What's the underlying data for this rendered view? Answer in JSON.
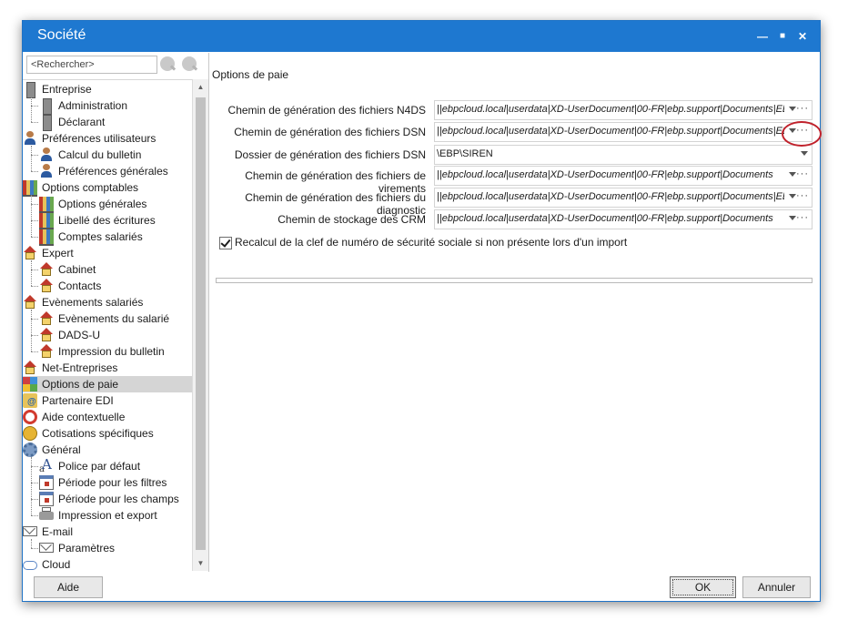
{
  "window": {
    "title": "Société"
  },
  "search": {
    "placeholder": "<Rechercher>"
  },
  "tree": [
    {
      "label": "Entreprise",
      "icon": "building-icon"
    },
    {
      "label": "Administration",
      "icon": "building-icon"
    },
    {
      "label": "Déclarant",
      "icon": "building-icon"
    },
    {
      "label": "Préférences utilisateurs",
      "icon": "user-icon"
    },
    {
      "label": "Calcul du bulletin",
      "icon": "user-icon"
    },
    {
      "label": "Préférences générales",
      "icon": "user-icon"
    },
    {
      "label": "Options comptables",
      "icon": "books-icon"
    },
    {
      "label": "Options générales",
      "icon": "books-icon"
    },
    {
      "label": "Libellé des écritures",
      "icon": "books-icon"
    },
    {
      "label": "Comptes salariés",
      "icon": "books-icon"
    },
    {
      "label": "Expert",
      "icon": "house-icon"
    },
    {
      "label": "Cabinet",
      "icon": "house-icon"
    },
    {
      "label": "Contacts",
      "icon": "house-icon"
    },
    {
      "label": "Evènements salariés",
      "icon": "house-icon"
    },
    {
      "label": "Evènements du salarié",
      "icon": "house-icon"
    },
    {
      "label": "DADS-U",
      "icon": "house-icon"
    },
    {
      "label": "Impression du bulletin",
      "icon": "house-icon"
    },
    {
      "label": "Net-Entreprises",
      "icon": "house-icon"
    },
    {
      "label": "Options de paie",
      "icon": "color-grid-icon"
    },
    {
      "label": "Partenaire EDI",
      "icon": "folder-at-icon"
    },
    {
      "label": "Aide contextuelle",
      "icon": "lifebuoy-icon"
    },
    {
      "label": "Cotisations spécifiques",
      "icon": "coins-icon"
    },
    {
      "label": "Général",
      "icon": "gear-icon"
    },
    {
      "label": "Police par défaut",
      "icon": "font-icon"
    },
    {
      "label": "Période pour les filtres",
      "icon": "calendar-icon"
    },
    {
      "label": "Période pour les champs",
      "icon": "calendar-icon"
    },
    {
      "label": "Impression et export",
      "icon": "printer-icon"
    },
    {
      "label": "E-mail",
      "icon": "mail-icon"
    },
    {
      "label": "Paramètres",
      "icon": "mail-icon"
    },
    {
      "label": "Cloud",
      "icon": "cloud-icon"
    }
  ],
  "panel": {
    "title": "Options de paie"
  },
  "fields": [
    {
      "label": "Chemin de génération des fichiers N4DS",
      "value": "||ebpcloud.local|userdata|XD-UserDocument|00-FR|ebp.support|Documents|EBP|Paie"
    },
    {
      "label": "Chemin de génération des fichiers DSN",
      "value": "||ebpcloud.local|userdata|XD-UserDocument|00-FR|ebp.support|Documents|EBP|Paie"
    },
    {
      "label": "Dossier de génération des fichiers DSN",
      "value": "\\EBP\\SIREN"
    },
    {
      "label": "Chemin de génération des fichiers de virements",
      "value": "||ebpcloud.local|userdata|XD-UserDocument|00-FR|ebp.support|Documents"
    },
    {
      "label": "Chemin de génération des fichiers du diagnostic",
      "value": "||ebpcloud.local|userdata|XD-UserDocument|00-FR|ebp.support|Documents|EBP|Paie"
    },
    {
      "label": "Chemin de stockage des CRM",
      "value": "||ebpcloud.local|userdata|XD-UserDocument|00-FR|ebp.support|Documents"
    }
  ],
  "checkbox": {
    "label": "Recalcul de la clef de numéro de sécurité sociale si non présente lors d'un import",
    "checked": true
  },
  "buttons": {
    "help": "Aide",
    "ok": "OK",
    "cancel": "Annuler"
  },
  "glyphs": {
    "minimize": "—",
    "maximize": "■",
    "close": "✕",
    "ellipsis": "···",
    "up": "▲",
    "down": "▼"
  },
  "colors": {
    "titlebar": "#1e78d0",
    "selection": "#d5d5d5",
    "highlight_circle": "#c0212b"
  }
}
